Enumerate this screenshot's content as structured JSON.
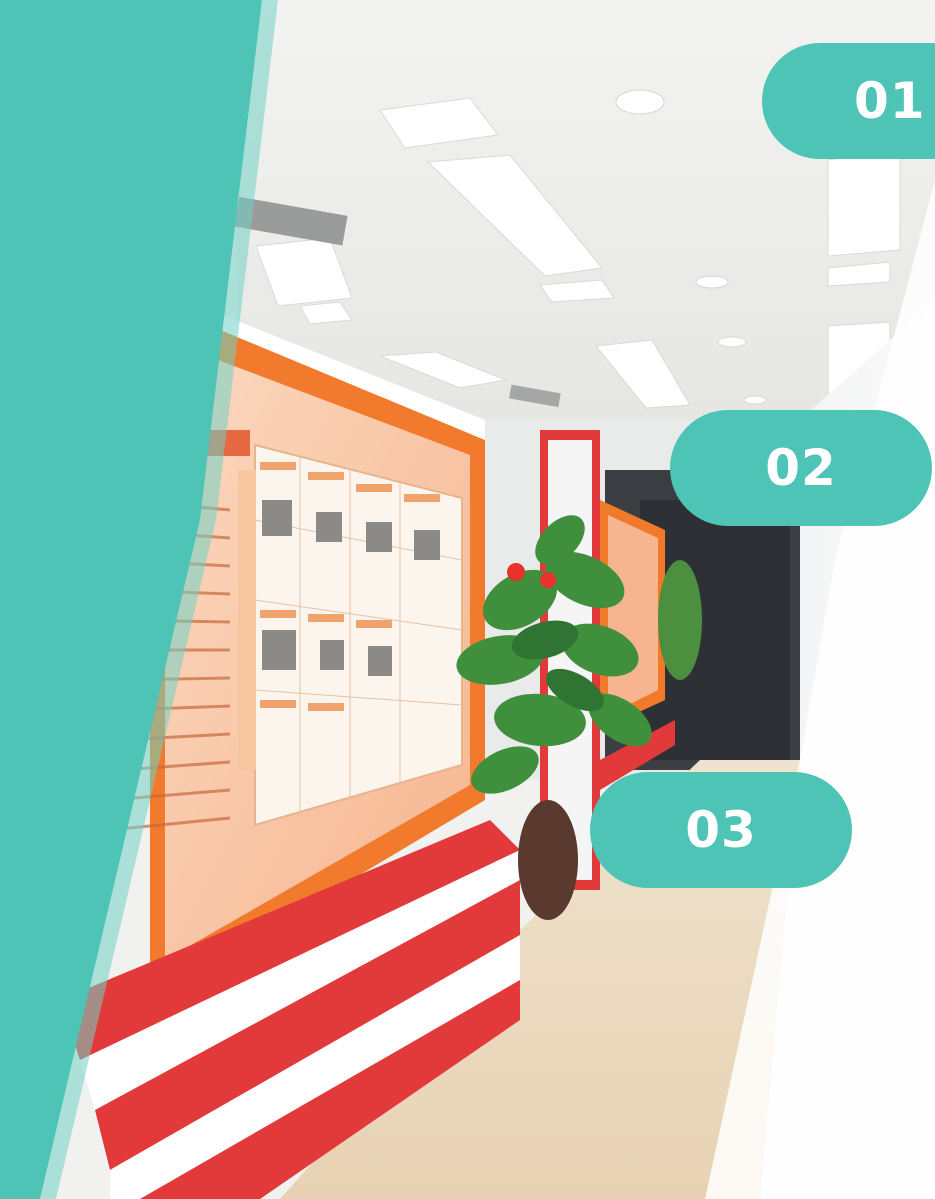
{
  "colors": {
    "accent_teal": "#4ec4b6",
    "banner_red": "#e23a3a",
    "banner_orange": "#f07a2a",
    "badge_text": "#ffffff"
  },
  "badges": [
    {
      "label": "01"
    },
    {
      "label": "02"
    },
    {
      "label": "03"
    }
  ]
}
